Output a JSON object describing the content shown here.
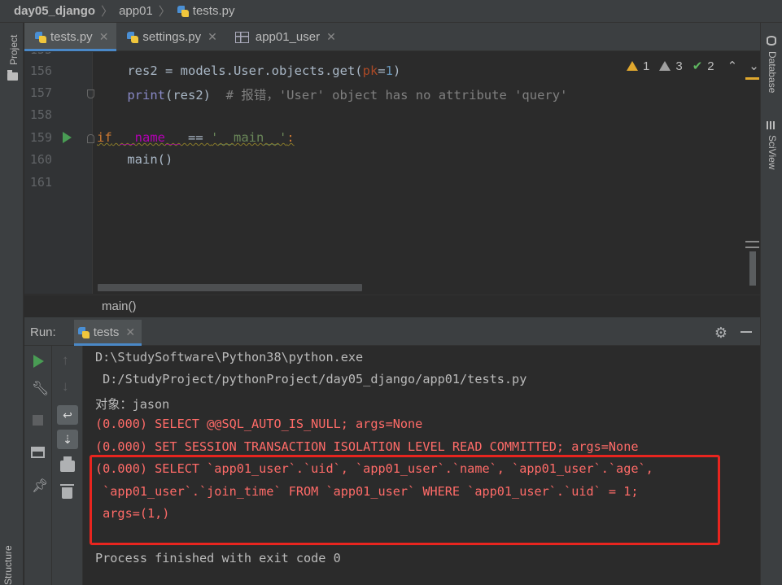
{
  "breadcrumb": {
    "project": "day05_django",
    "folder": "app01",
    "file": "tests.py"
  },
  "side_tools": {
    "project": "Project",
    "database": "Database",
    "sciview": "SciView",
    "structure": "Structure"
  },
  "tabs": [
    {
      "label": "tests.py",
      "active": true
    },
    {
      "label": "settings.py",
      "active": false
    },
    {
      "label": "app01_user",
      "active": false
    }
  ],
  "inspections": {
    "warnings": "1",
    "weak_warnings": "3",
    "typos": "2"
  },
  "editor": {
    "lines": [
      {
        "num": "156"
      },
      {
        "num": "157"
      },
      {
        "num": "158"
      },
      {
        "num": "159"
      },
      {
        "num": "160"
      },
      {
        "num": "161"
      }
    ],
    "code": {
      "l156_a": "    res2 = models.User.objects.get(",
      "l156_param": "pk",
      "l156_eq": "=",
      "l156_num": "1",
      "l156_end": ")",
      "l157_print": "print",
      "l157_mid": "(res2)  ",
      "l157_comment": "# 报错，'User' object has no attribute 'query'",
      "l159_if": "if",
      "l159_name": " __name__",
      "l159_eq": " == ",
      "l159_str": "'__main__'",
      "l159_colon": ":",
      "l160": "    main()"
    }
  },
  "status_breadcrumb": "main()",
  "run_panel": {
    "label": "Run:",
    "tab": "tests"
  },
  "console": {
    "lines": [
      {
        "text": "D:\\StudySoftware\\Python38\\python.exe",
        "color": "white"
      },
      {
        "text": " D:/StudyProject/pythonProject/day05_django/app01/tests.py",
        "color": "white"
      },
      {
        "text": "对象：jason",
        "color": "white"
      },
      {
        "text": "(0.000) SELECT @@SQL_AUTO_IS_NULL; args=None",
        "color": "red"
      },
      {
        "text": "(0.000) SET SESSION TRANSACTION ISOLATION LEVEL READ COMMITTED; args=None",
        "color": "red"
      },
      {
        "text": "(0.000) SELECT `app01_user`.`uid`, `app01_user`.`name`, `app01_user`.`age`,",
        "color": "red"
      },
      {
        "text": " `app01_user`.`join_time` FROM `app01_user` WHERE `app01_user`.`uid` = 1;",
        "color": "red"
      },
      {
        "text": " args=(1,)",
        "color": "red"
      },
      {
        "text": "Process finished with exit code 0",
        "color": "white"
      }
    ]
  },
  "colors": {
    "background": "#2b2b2b",
    "panel": "#3c3f41",
    "error_text": "#ff6b68",
    "highlight_box": "#e8251f",
    "accent_tab": "#4a88c7"
  }
}
